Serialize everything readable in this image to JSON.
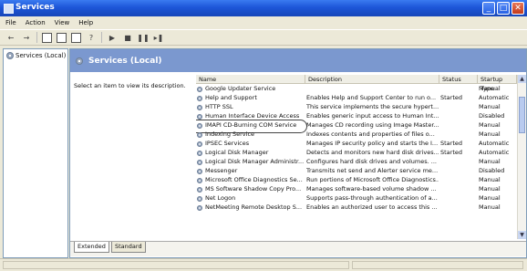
{
  "window": {
    "title": "Services"
  },
  "menu": [
    "File",
    "Action",
    "View",
    "Help"
  ],
  "tree": {
    "root_label": "Services (Local)"
  },
  "pane": {
    "header_title": "Services (Local)",
    "description_prompt": "Select an item to view its description."
  },
  "columns": {
    "name": "Name",
    "description": "Description",
    "status": "Status",
    "startup": "Startup Type"
  },
  "services": [
    {
      "name": "Google Updater Service",
      "description": "",
      "status": "",
      "startup": "Manual"
    },
    {
      "name": "Help and Support",
      "description": "Enables Help and Support Center to run o...",
      "status": "Started",
      "startup": "Automatic"
    },
    {
      "name": "HTTP SSL",
      "description": "This service implements the secure hypert...",
      "status": "",
      "startup": "Manual"
    },
    {
      "name": "Human Interface Device Access",
      "description": "Enables generic input access to Human Int...",
      "status": "",
      "startup": "Disabled"
    },
    {
      "name": "IMAPI CD-Burning COM Service",
      "description": "Manages CD recording using Image Master...",
      "status": "",
      "startup": "Manual"
    },
    {
      "name": "Indexing Service",
      "description": "Indexes contents and properties of files o...",
      "status": "",
      "startup": "Manual"
    },
    {
      "name": "IPSEC Services",
      "description": "Manages IP security policy and starts the I...",
      "status": "Started",
      "startup": "Automatic"
    },
    {
      "name": "Logical Disk Manager",
      "description": "Detects and monitors new hard disk drives...",
      "status": "Started",
      "startup": "Automatic"
    },
    {
      "name": "Logical Disk Manager Administr...",
      "description": "Configures hard disk drives and volumes. ...",
      "status": "",
      "startup": "Manual"
    },
    {
      "name": "Messenger",
      "description": "Transmits net send and Alerter service me...",
      "status": "",
      "startup": "Disabled"
    },
    {
      "name": "Microsoft Office Diagnostics Se...",
      "description": "Run portions of Microsoft Office Diagnostics...",
      "status": "",
      "startup": "Manual"
    },
    {
      "name": "MS Software Shadow Copy Pro...",
      "description": "Manages software-based volume shadow ...",
      "status": "",
      "startup": "Manual"
    },
    {
      "name": "Net Logon",
      "description": "Supports pass-through authentication of a...",
      "status": "",
      "startup": "Manual"
    },
    {
      "name": "NetMeeting Remote Desktop S...",
      "description": "Enables an authorized user to access this ...",
      "status": "",
      "startup": "Manual"
    }
  ],
  "tabs": [
    "Extended",
    "Standard"
  ]
}
